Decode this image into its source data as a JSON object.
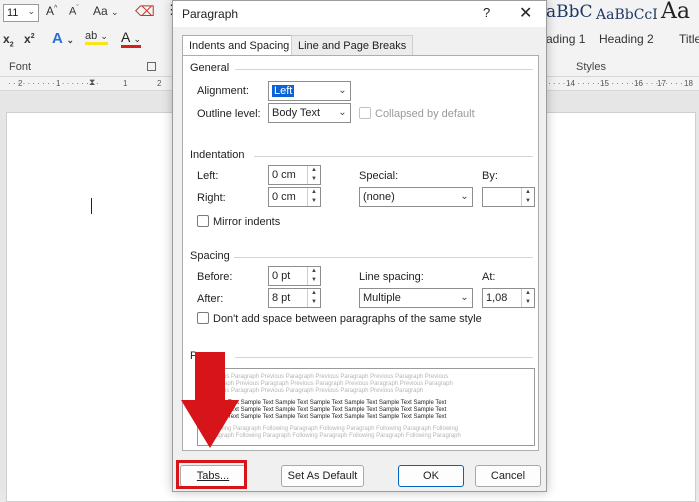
{
  "ribbon": {
    "font_size": "11",
    "grow_font": "A",
    "shrink_font": "A",
    "change_case": "Aa",
    "subscript": "x",
    "superscript": "x",
    "text_effects": "A",
    "highlight": "ab",
    "font_color": "A",
    "font_group": "Font",
    "styles_group": "Styles",
    "styles": [
      {
        "preview": "aBbC",
        "name": "ading 1"
      },
      {
        "preview": "AaBbCcI",
        "name": "Heading 2"
      },
      {
        "preview": "Aa",
        "name": "Title"
      }
    ]
  },
  "ruler": {
    "left_marks": [
      "2",
      "1",
      "1",
      "2"
    ],
    "right_marks": [
      "14",
      "15",
      "16",
      "17",
      "18"
    ]
  },
  "dialog": {
    "title": "Paragraph",
    "help": "?",
    "close": "✕",
    "tabs": [
      "Indents and Spacing",
      "Line and Page Breaks"
    ],
    "general": {
      "heading": "General",
      "alignment_label": "Alignment:",
      "alignment_value": "Left",
      "outline_label": "Outline level:",
      "outline_value": "Body Text",
      "collapsed_label": "Collapsed by default"
    },
    "indentation": {
      "heading": "Indentation",
      "left_label": "Left:",
      "left_value": "0 cm",
      "right_label": "Right:",
      "right_value": "0 cm",
      "special_label": "Special:",
      "special_value": "(none)",
      "by_label": "By:",
      "by_value": "",
      "mirror_label": "Mirror indents"
    },
    "spacing": {
      "heading": "Spacing",
      "before_label": "Before:",
      "before_value": "0 pt",
      "after_label": "After:",
      "after_value": "8 pt",
      "line_spacing_label": "Line spacing:",
      "line_spacing_value": "Multiple",
      "at_label": "At:",
      "at_value": "1,08",
      "dont_add_label": "Don't add space between paragraphs of the same style"
    },
    "preview": {
      "heading": "Prev",
      "previous_lines": [
        "Previous Paragraph Previous Paragraph Previous Paragraph Previous Paragraph Previous",
        "Paragraph Previous Paragraph Previous Paragraph Previous Paragraph Previous Paragraph",
        "Previous Paragraph Previous Paragraph Previous Paragraph Previous Paragraph"
      ],
      "sample_lines": [
        "Sample Text Sample Text Sample Text Sample Text Sample Text Sample Text Sample Text",
        "Sample Text Sample Text Sample Text Sample Text Sample Text Sample Text Sample Text",
        "Sample Text Sample Text Sample Text Sample Text Sample Text Sample Text Sample Text"
      ],
      "following_lines": [
        "Following Paragraph Following Paragraph Following Paragraph Following Paragraph Following",
        "Paragraph Following Paragraph Following Paragraph Following Paragraph Following Paragraph"
      ]
    },
    "buttons": {
      "tabs": "Tabs...",
      "set_default": "Set As Default",
      "ok": "OK",
      "cancel": "Cancel"
    }
  },
  "annotation": {
    "color": "#d7141a"
  }
}
